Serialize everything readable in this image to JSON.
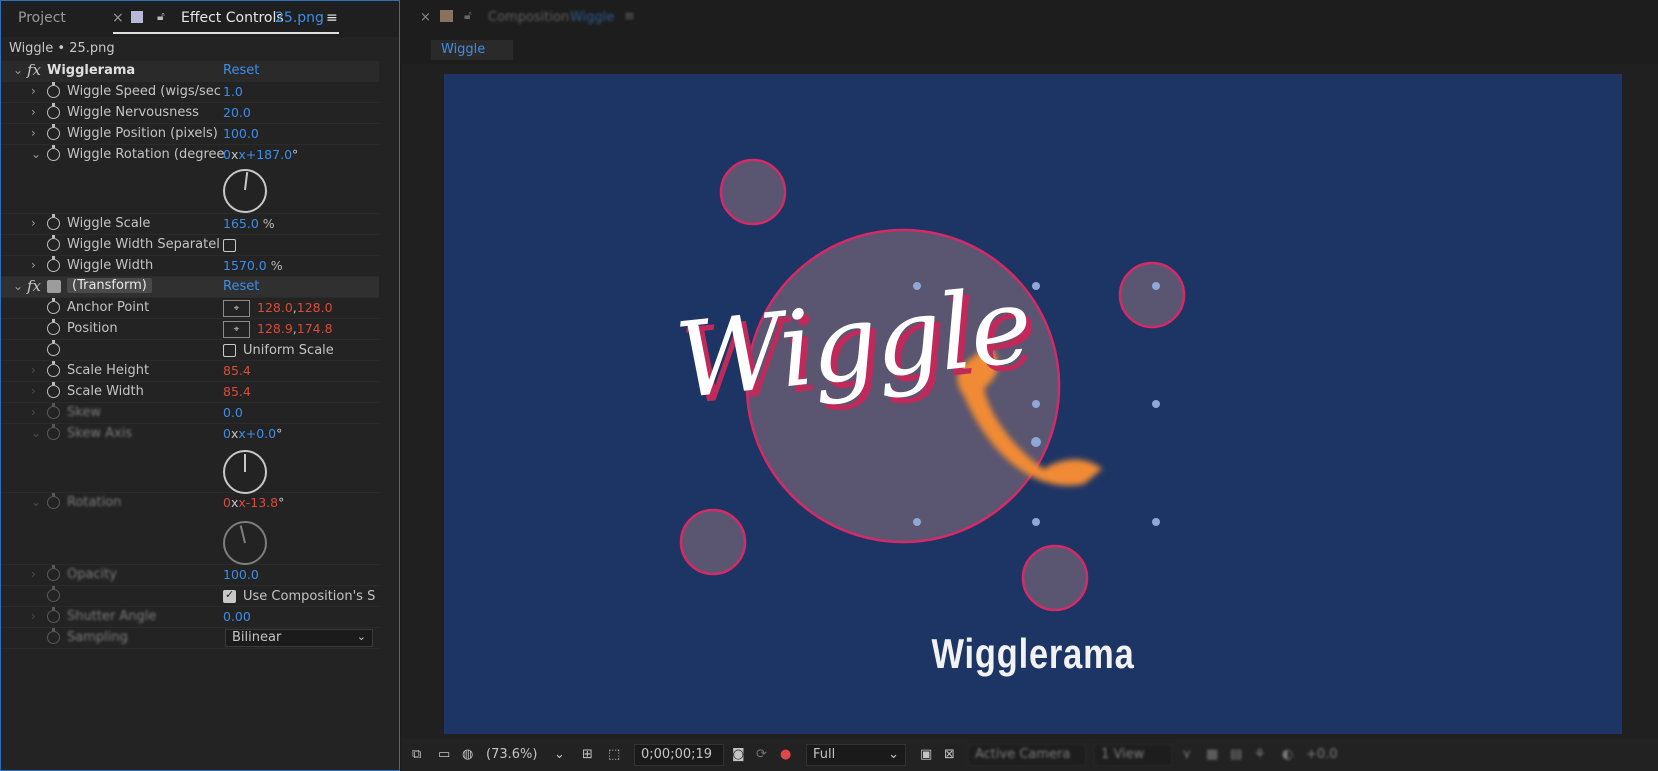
{
  "left_panel": {
    "tabs": {
      "project": "Project",
      "close": "×",
      "effect_controls": "Effect Controls",
      "effect_file": "25.png",
      "menu": "≡"
    },
    "subtitle": "Wiggle • 25.png",
    "wigglerama": {
      "label": "Wigglerama",
      "reset": "Reset",
      "speed_label": "Wiggle Speed (wigs/sec",
      "speed_value": "1.0",
      "nervousness_label": "Wiggle Nervousness",
      "nervousness_value": "20.0",
      "position_label": "Wiggle Position (pixels)",
      "position_value": "100.0",
      "rotation_label": "Wiggle Rotation (degree",
      "rotation_value_a": "0",
      "rotation_value_b": "x+187.0",
      "rotation_unit": "°",
      "scale_label": "Wiggle Scale",
      "scale_value": "165.0",
      "scale_unit": "%",
      "width_sep_label": "Wiggle Width Separatel",
      "width_label": "Wiggle Width",
      "width_value": "1570.0",
      "width_unit": "%"
    },
    "transform": {
      "label": "(Transform)",
      "reset": "Reset",
      "anchor_label": "Anchor Point",
      "anchor_x": "128.0",
      "anchor_y": "128.0",
      "position_label": "Position",
      "position_x": "128.9",
      "position_y": "174.8",
      "uniform_scale": "Uniform Scale",
      "scale_height_label": "Scale Height",
      "scale_height_value": "85.4",
      "scale_width_label": "Scale Width",
      "scale_width_value": "85.4",
      "skew_label": "Skew",
      "skew_value": "0.0",
      "skew_axis_label": "Skew Axis",
      "skew_axis_a": "0",
      "skew_axis_b": "x+0.0",
      "skew_axis_unit": "°",
      "rotation_label": "Rotation",
      "rotation_a": "0",
      "rotation_b": "x-13.8",
      "rotation_unit": "°",
      "opacity_label": "Opacity",
      "opacity_value": "100.0",
      "use_comp_shutter": "Use Composition's S",
      "shutter_angle_label": "Shutter Angle",
      "shutter_angle_value": "0.00",
      "sampling_label": "Sampling",
      "sampling_value": "Bilinear"
    },
    "sep": ","
  },
  "right_panel": {
    "comp_tab_close": "×",
    "comp_tab_label": "Composition",
    "comp_tab_name": "Wiggle",
    "comp_tab_menu": "≡",
    "viewer_tab": "Wiggle",
    "canvas_logo": "Wiggle",
    "canvas_title": "Wigglerama",
    "bottom": {
      "zoom": "(73.6%)",
      "timecode": "0;00;00;19",
      "resolution": "Full",
      "camera": "Active Camera",
      "views": "1 View",
      "plus": "+0.0"
    }
  },
  "colors": {
    "accent_blue": "#3b8ee8",
    "value_red": "#d94b3a",
    "canvas_bg": "#1d3565",
    "circle_fill": "#5a5570",
    "circle_stroke": "#d62a66",
    "phone_orange": "#f08a35"
  },
  "icons": [
    "stopwatch-icon",
    "fx-icon",
    "chevron-icon",
    "target-icon",
    "camera-icon",
    "color-channel-icon"
  ]
}
